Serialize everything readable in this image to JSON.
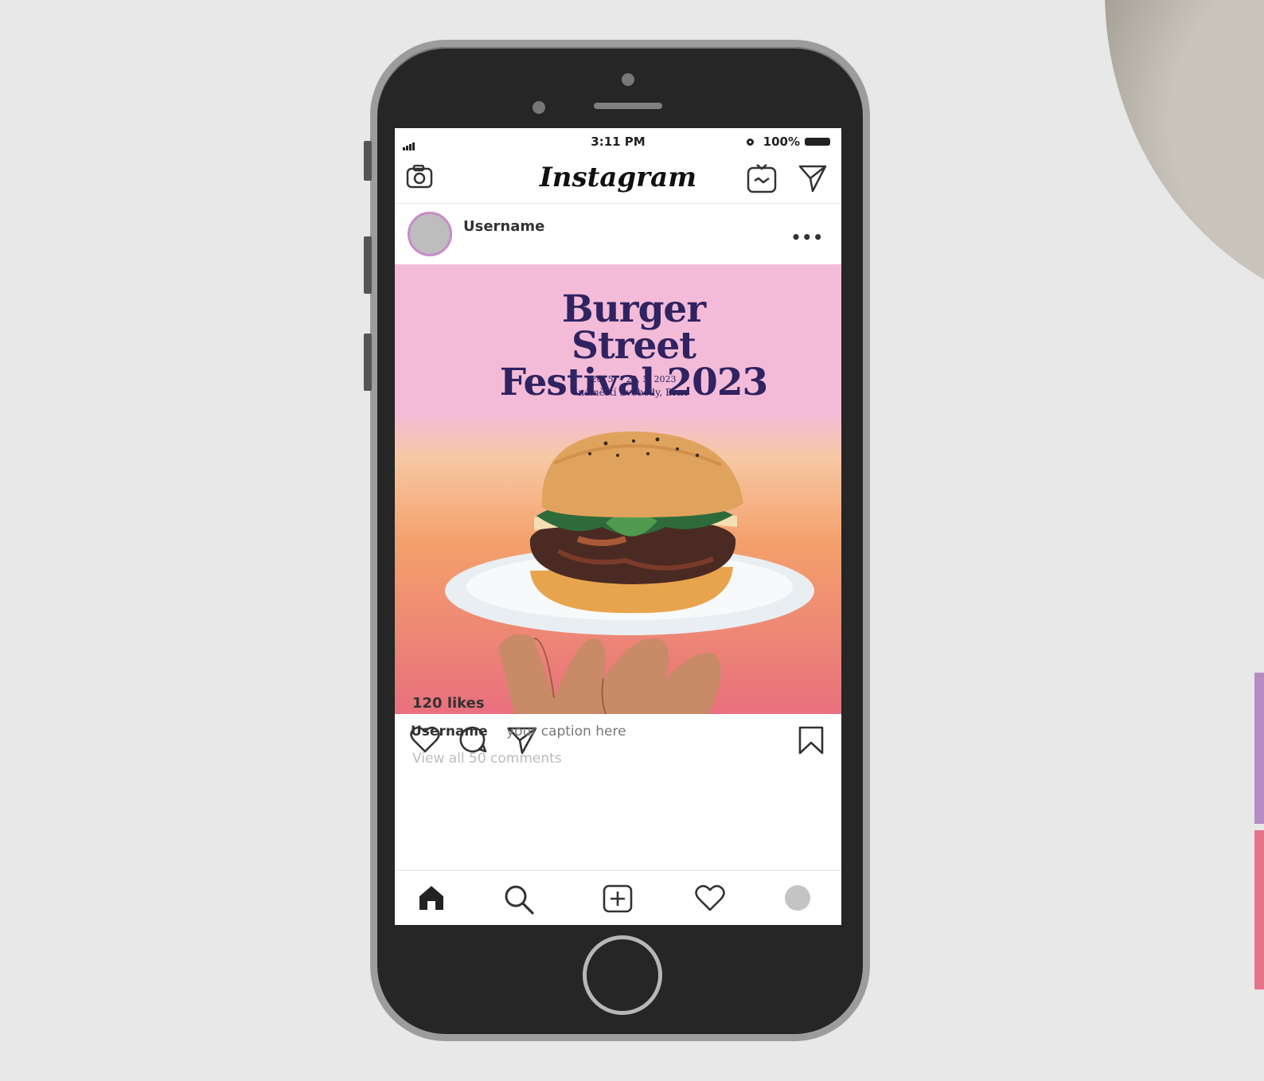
{
  "status_bar": {
    "time": "3:11 PM",
    "battery": "100%"
  },
  "header": {
    "app_name": "Instagram"
  },
  "post": {
    "username": "Username",
    "more": "•••",
    "image": {
      "title_line1": "Burger Street",
      "title_line2": "Festival 2023",
      "dates": "26. 5. – 28. 5. 2023",
      "venue": "náměstí Svobody, Brno"
    },
    "likes": "120 likes",
    "caption_user": "Username",
    "caption_text": "your caption here",
    "view_comments": "View all 50 comments"
  },
  "icons": {
    "camera": "camera-icon",
    "igtv": "igtv-icon",
    "direct": "paper-plane-icon",
    "like": "heart-icon",
    "comment": "comment-icon",
    "share": "paper-plane-icon",
    "save": "bookmark-icon",
    "home": "home-icon",
    "search": "search-icon",
    "new_post": "plus-square-icon",
    "activity": "heart-icon",
    "profile": "profile-avatar-icon"
  },
  "colors": {
    "poster_text": "#2f2361",
    "poster_pink": "#f4bbd8",
    "poster_orange": "#f4a06b",
    "poster_coral": "#e9707e"
  }
}
